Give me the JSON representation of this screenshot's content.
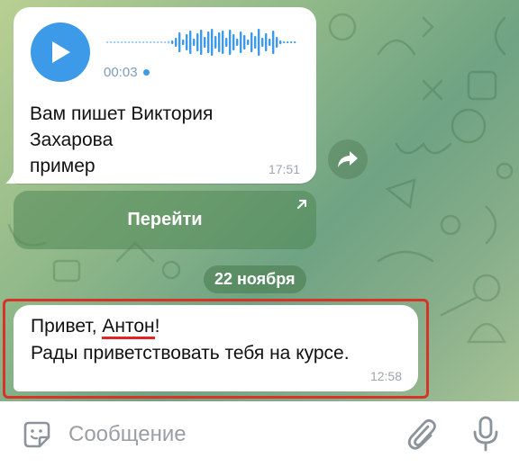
{
  "colors": {
    "accent": "#3d9ae8",
    "highlight": "#d6342b",
    "bubble": "#ffffff"
  },
  "voice_message": {
    "duration": "00:03",
    "play_icon": "play-icon"
  },
  "message1": {
    "text": "Вам пишет Виктория\nЗахарова\nпример",
    "time": "17:51"
  },
  "forward_icon": "share-arrow-icon",
  "inline_button": {
    "label": "Перейти",
    "icon": "external-link-arrow-icon"
  },
  "date_separator": "22 ноября",
  "message2": {
    "greeting": "Привет, ",
    "name": "Антон",
    "exclamation": "!",
    "line2": "Рады приветствовать тебя на курсе.",
    "time": "12:58"
  },
  "composer": {
    "placeholder": "Сообщение",
    "value": "",
    "sticker_icon": "sticker-icon",
    "attach_icon": "paperclip-icon",
    "mic_icon": "microphone-icon"
  }
}
